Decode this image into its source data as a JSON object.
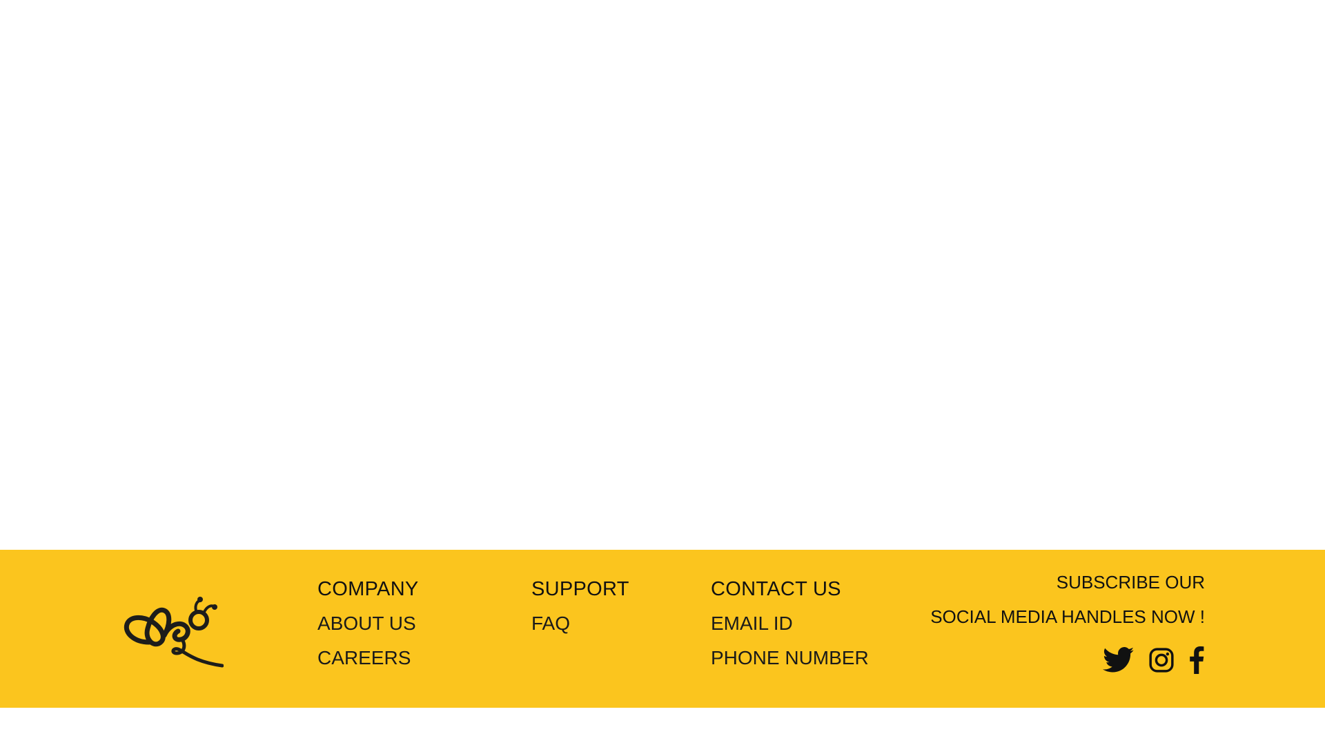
{
  "footer": {
    "background_color": "#FBC51E",
    "logo_icon": "bee-logo-icon",
    "columns": {
      "company": {
        "heading": "COMPANY",
        "links": [
          "ABOUT US",
          "CAREERS"
        ]
      },
      "support": {
        "heading": "SUPPORT",
        "links": [
          "FAQ"
        ]
      },
      "contact": {
        "heading": "CONTACT US",
        "links": [
          "EMAIL ID",
          "PHONE NUMBER"
        ]
      }
    },
    "subscribe": {
      "line1": "SUBSCRIBE OUR",
      "line2": "SOCIAL MEDIA HANDLES NOW !"
    },
    "social_icons": [
      "twitter-icon",
      "instagram-icon",
      "facebook-icon"
    ]
  }
}
